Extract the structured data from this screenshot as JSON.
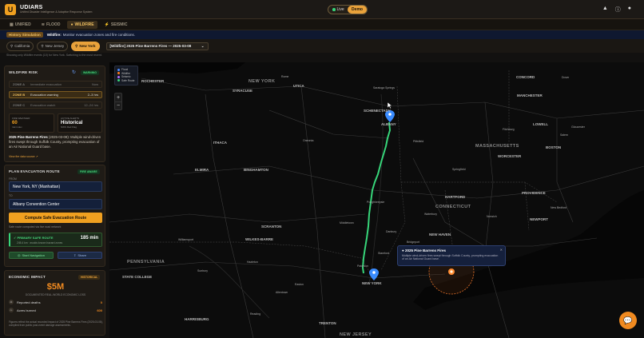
{
  "app": {
    "logo": "U",
    "title": "UDIARS",
    "subtitle": "Unified Disaster Intelligence & Adaptive Response System"
  },
  "mode": {
    "live": "Live",
    "demo": "Demo"
  },
  "header_icons": [
    "warning-icon",
    "info-icon",
    "user-icon"
  ],
  "tabs": [
    {
      "icon": "▦",
      "label": "UNIFIED"
    },
    {
      "icon": "≋",
      "label": "FLOOD"
    },
    {
      "icon": "●",
      "label": "WILDFIRE"
    },
    {
      "icon": "⚡",
      "label": "SEISMIC"
    }
  ],
  "banner": {
    "pill": "History Simulation",
    "label": "Wildfire:",
    "text": "Monitor evacuation zones and fire conditions."
  },
  "locations": [
    {
      "label": "California"
    },
    {
      "label": "New Jersey"
    },
    {
      "label": "New York"
    }
  ],
  "event_select": "[Wildfire] 2025 Pine Barrens Fires — 2025-03-08",
  "subinfo": "Showing only Wildfire events (10) for New York. Switching to the most recent.",
  "risk": {
    "title": "WILDFIRE RISK",
    "badge": "WARNING",
    "zones": [
      {
        "zone": "ZONE A",
        "text": "Immediate evacuation",
        "time": "Now"
      },
      {
        "zone": "ZONE B",
        "text": "Evacuation warning",
        "time": "2–3 hrs"
      },
      {
        "zone": "ZONE C",
        "text": "Evacuation watch",
        "time": "12–24 hrs"
      }
    ],
    "fire_weather": {
      "label": "FIRE WEATHER",
      "value": "60",
      "unit": "risk index"
    },
    "active_alerts": {
      "label": "ACTIVE ALERTS",
      "value": "Historical",
      "unit": "NWS Red Flag"
    },
    "description_title": "2025 Pine Barrens Fires",
    "description": " (2025-03-08): Multiple wind-driven fires swept through Suffolk County, prompting evacuation of an Air National Guard base.",
    "link": "View fire data source ↗"
  },
  "evac": {
    "title": "PLAN EVACUATION ROUTE",
    "badge": "FIRE AWARE",
    "from_label": "FROM",
    "from_value": "New York, NY (Manhattan)",
    "to_label": "TO",
    "to_value": "Albany Convention Center",
    "compute": "Compute Safe Evacuation Route",
    "note": "Safe route computed via live road network",
    "route_title": "PRIMARY SAFE ROUTE",
    "route_time": "185 min",
    "route_sub": "245.4 km · avoids known hazard zones",
    "start": "Start Navigation",
    "share": "Share"
  },
  "economic": {
    "title": "ECONOMIC IMPACT",
    "badge": "HISTORICAL",
    "value": "$5M",
    "caption": "DOCUMENTED REAL-WORLD ECONOMIC LOSS",
    "rows": [
      {
        "label": "Reported deaths",
        "value": "0"
      },
      {
        "label": "Acres burned",
        "value": "600"
      }
    ],
    "footnote": "Figures reflect the actual recorded impact of 2025 Pine Barrens Fires (2025-03-08), compiled from public post-event damage assessments."
  },
  "legend": [
    {
      "label": "Flood",
      "color": "#4a8cff"
    },
    {
      "label": "Wildfire",
      "color": "#ff7a1a"
    },
    {
      "label": "Seismic",
      "color": "#b06cff"
    },
    {
      "label": "Safe Route",
      "color": "#37d67a"
    }
  ],
  "zoom": {
    "in": "+",
    "out": "−"
  },
  "popup": {
    "title": "2025 Pine Barrens Fires",
    "text": "Multiple wind-driven fires swept through Suffolk County, prompting evacuation of an Air National Guard base.",
    "close": "✕"
  },
  "cities": {
    "rochester": "ROCHESTER",
    "newyork_state": "NEW YORK",
    "utica": "UTICA",
    "syracuse": "SYRACUSE",
    "rome": "Rome",
    "saratoga": "Saratoga Springs",
    "schenectady": "SCHENECTADY",
    "albany": "ALBANY",
    "concord": "CONCORD",
    "dover": "Dover",
    "manchester": "MANCHESTER",
    "lowell": "LOWELL",
    "gloucester": "Gloucester",
    "fitchburg": "Fitchburg",
    "salem": "Salem",
    "boston": "BOSTON",
    "worcester": "WORCESTER",
    "massachusetts": "MASSACHUSETTS",
    "pittsfield": "Pittsfield",
    "ithaca": "ITHACA",
    "oneonta": "Oneonta",
    "elmira": "ELMIRA",
    "binghamton": "BINGHAMTON",
    "springfield": "Springfield",
    "hartford": "HARTFORD",
    "providence": "PROVIDENCE",
    "new_bedford": "New Bedford",
    "norwich": "Norwich",
    "waterbury": "Waterbury",
    "connecticut": "CONNECTICUT",
    "newport": "NEWPORT",
    "poughkeepsie": "Poughkeepsie",
    "new_haven": "NEW HAVEN",
    "bridgeport": "Bridgeport",
    "scranton": "SCRANTON",
    "middletown": "Middletown",
    "danbury": "Danbury",
    "williamsport": "Williamsport",
    "wilkes_barre": "WILKES-BARRE",
    "stamford": "Stamford",
    "paterson": "Paterson",
    "pennsylvania": "PENNSYLVANIA",
    "hazleton": "Hazleton",
    "state_college": "STATE COLLEGE",
    "sunbury": "Sunbury",
    "newyork_city": "NEW YORK",
    "easton": "Easton",
    "allentown": "Allentown",
    "harrisburg": "HARRISBURG",
    "reading": "Reading",
    "trenton": "TRENTON",
    "new_jersey": "NEW JERSEY"
  }
}
